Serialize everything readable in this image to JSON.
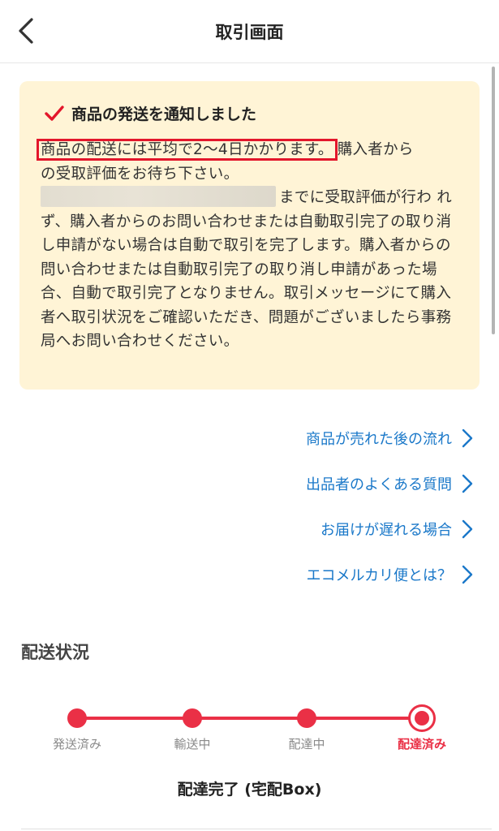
{
  "header": {
    "title": "取引画面",
    "back_icon": "chevron-left-icon"
  },
  "notice": {
    "icon": "checkmark-icon",
    "icon_color": "#e3162b",
    "title": "商品の発送を通知しました",
    "highlight_text": "商品の配送には平均で2〜4日かかります。",
    "highlight_color": "#e3162b",
    "line1_rest": "購入者から",
    "line2": "の受取評価をお待ち下さい。",
    "line3_rest": "までに受取評価が行わ",
    "rest": "れず、購入者からのお問い合わせまたは自動取引完了の取り消し申請がない場合は自動で取引を完了します。購入者からの問い合わせまたは自動取引完了の取り消し申請があった場合、自動で取引完了となりません。取引メッセージにて購入者へ取引状況をご確認いただき、問題がございましたら事務局へお問い合わせください。"
  },
  "links": [
    {
      "label": "商品が売れた後の流れ"
    },
    {
      "label": "出品者のよくある質問"
    },
    {
      "label": "お届けが遅れる場合"
    },
    {
      "label": "エコメルカリ便とは？"
    }
  ],
  "delivery": {
    "section_title": "配送状況",
    "steps": [
      {
        "label": "発送済み"
      },
      {
        "label": "輸送中"
      },
      {
        "label": "配達中"
      },
      {
        "label": "配達済み"
      }
    ],
    "current_step_index": 3,
    "accent_color": "#ea3046",
    "status_text": "配達完了 (宅配Box)"
  }
}
